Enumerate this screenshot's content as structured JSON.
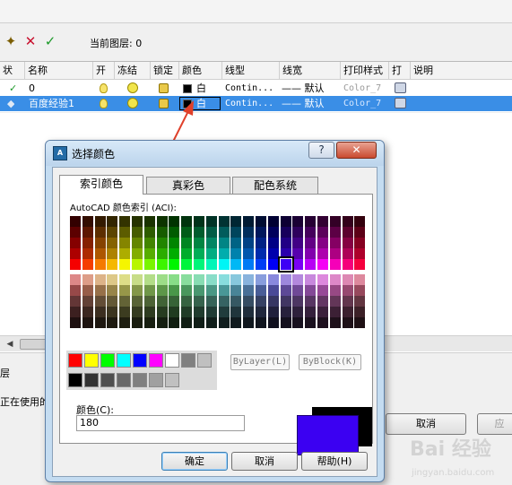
{
  "toolbar": {
    "current_layer_label": "当前图层: 0"
  },
  "layer_table": {
    "headers": [
      "状",
      "名称",
      "开",
      "冻结",
      "锁定",
      "颜色",
      "线型",
      "线宽",
      "打印样式",
      "打",
      "说明"
    ],
    "rows": [
      {
        "name": "0",
        "color_name": "白",
        "linetype": "Contin...",
        "lineweight": "—— 默认",
        "plot_style": "Color_7",
        "selected": false
      },
      {
        "name": "百度经验1",
        "color_name": "白",
        "linetype": "Contin...",
        "lineweight": "—— 默认",
        "plot_style": "Color_7",
        "selected": true
      }
    ]
  },
  "status": {
    "line1": "层",
    "line2": "正在使用的"
  },
  "background_buttons": {
    "cancel": "取消",
    "apply": "应"
  },
  "dialog": {
    "title": "选择颜色",
    "help_glyph": "?",
    "close_glyph": "✕",
    "tabs": [
      "索引颜色",
      "真彩色",
      "配色系统"
    ],
    "aci_caption": "AutoCAD 颜色索引 (ACI):",
    "bylayer_button": "ByLayer(L)",
    "byblock_button": "ByBlock(K)",
    "color_label": "颜色(C):",
    "color_value": "180",
    "ok_button": "确定",
    "cancel_button": "取消",
    "help_button": "帮助(H)"
  },
  "colors": {
    "selected_preview": "#3b00f2",
    "old_preview": "#000000",
    "selection_highlight": "#3a8ee6"
  },
  "watermark": {
    "text": "Bai 经验",
    "subtext": "jingyan.baidu.com"
  }
}
